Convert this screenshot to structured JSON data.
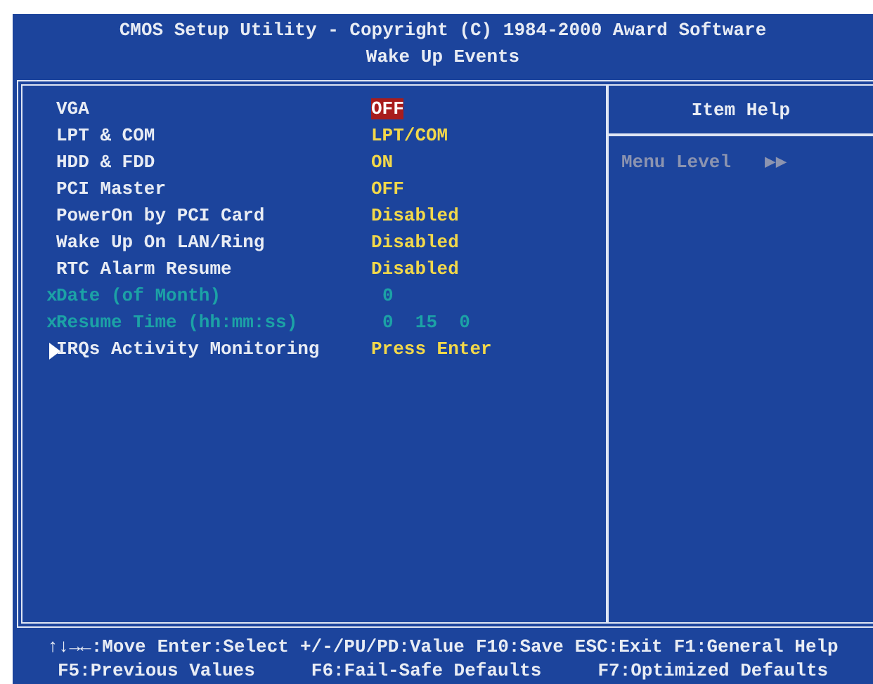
{
  "header": {
    "title": "CMOS Setup Utility - Copyright (C) 1984-2000 Award Software",
    "subtitle": "Wake Up Events"
  },
  "settings": [
    {
      "kind": "option",
      "label": "VGA",
      "value": "OFF",
      "selected": true
    },
    {
      "kind": "option",
      "label": "LPT & COM",
      "value": "LPT/COM",
      "selected": false
    },
    {
      "kind": "option",
      "label": "HDD & FDD",
      "value": "ON",
      "selected": false
    },
    {
      "kind": "option",
      "label": "PCI Master",
      "value": "OFF",
      "selected": false
    },
    {
      "kind": "option",
      "label": "PowerOn by PCI Card",
      "value": "Disabled",
      "selected": false
    },
    {
      "kind": "option",
      "label": "Wake Up On LAN/Ring",
      "value": "Disabled",
      "selected": false
    },
    {
      "kind": "option",
      "label": "RTC Alarm Resume",
      "value": "Disabled",
      "selected": false
    },
    {
      "kind": "locked",
      "marker": "x",
      "label": "Date (of Month)",
      "value": "0",
      "selected": false
    },
    {
      "kind": "locked",
      "marker": "x",
      "label": "Resume Time (hh:mm:ss)",
      "value": "0  15  0",
      "selected": false
    },
    {
      "kind": "submenu",
      "label": "IRQs Activity Monitoring",
      "value": "Press Enter",
      "selected": false
    }
  ],
  "item_help": {
    "title": "Item Help",
    "menu_level_label": "Menu Level",
    "menu_level_marker": "▶▶"
  },
  "footer": [
    [
      "↑↓→←:Move",
      "Enter:Select",
      "+/-/PU/PD:Value",
      "F10:Save",
      "ESC:Exit",
      "F1:General Help"
    ],
    [
      "F5:Previous Values",
      "F6:Fail-Safe Defaults",
      "F7:Optimized Defaults"
    ]
  ]
}
